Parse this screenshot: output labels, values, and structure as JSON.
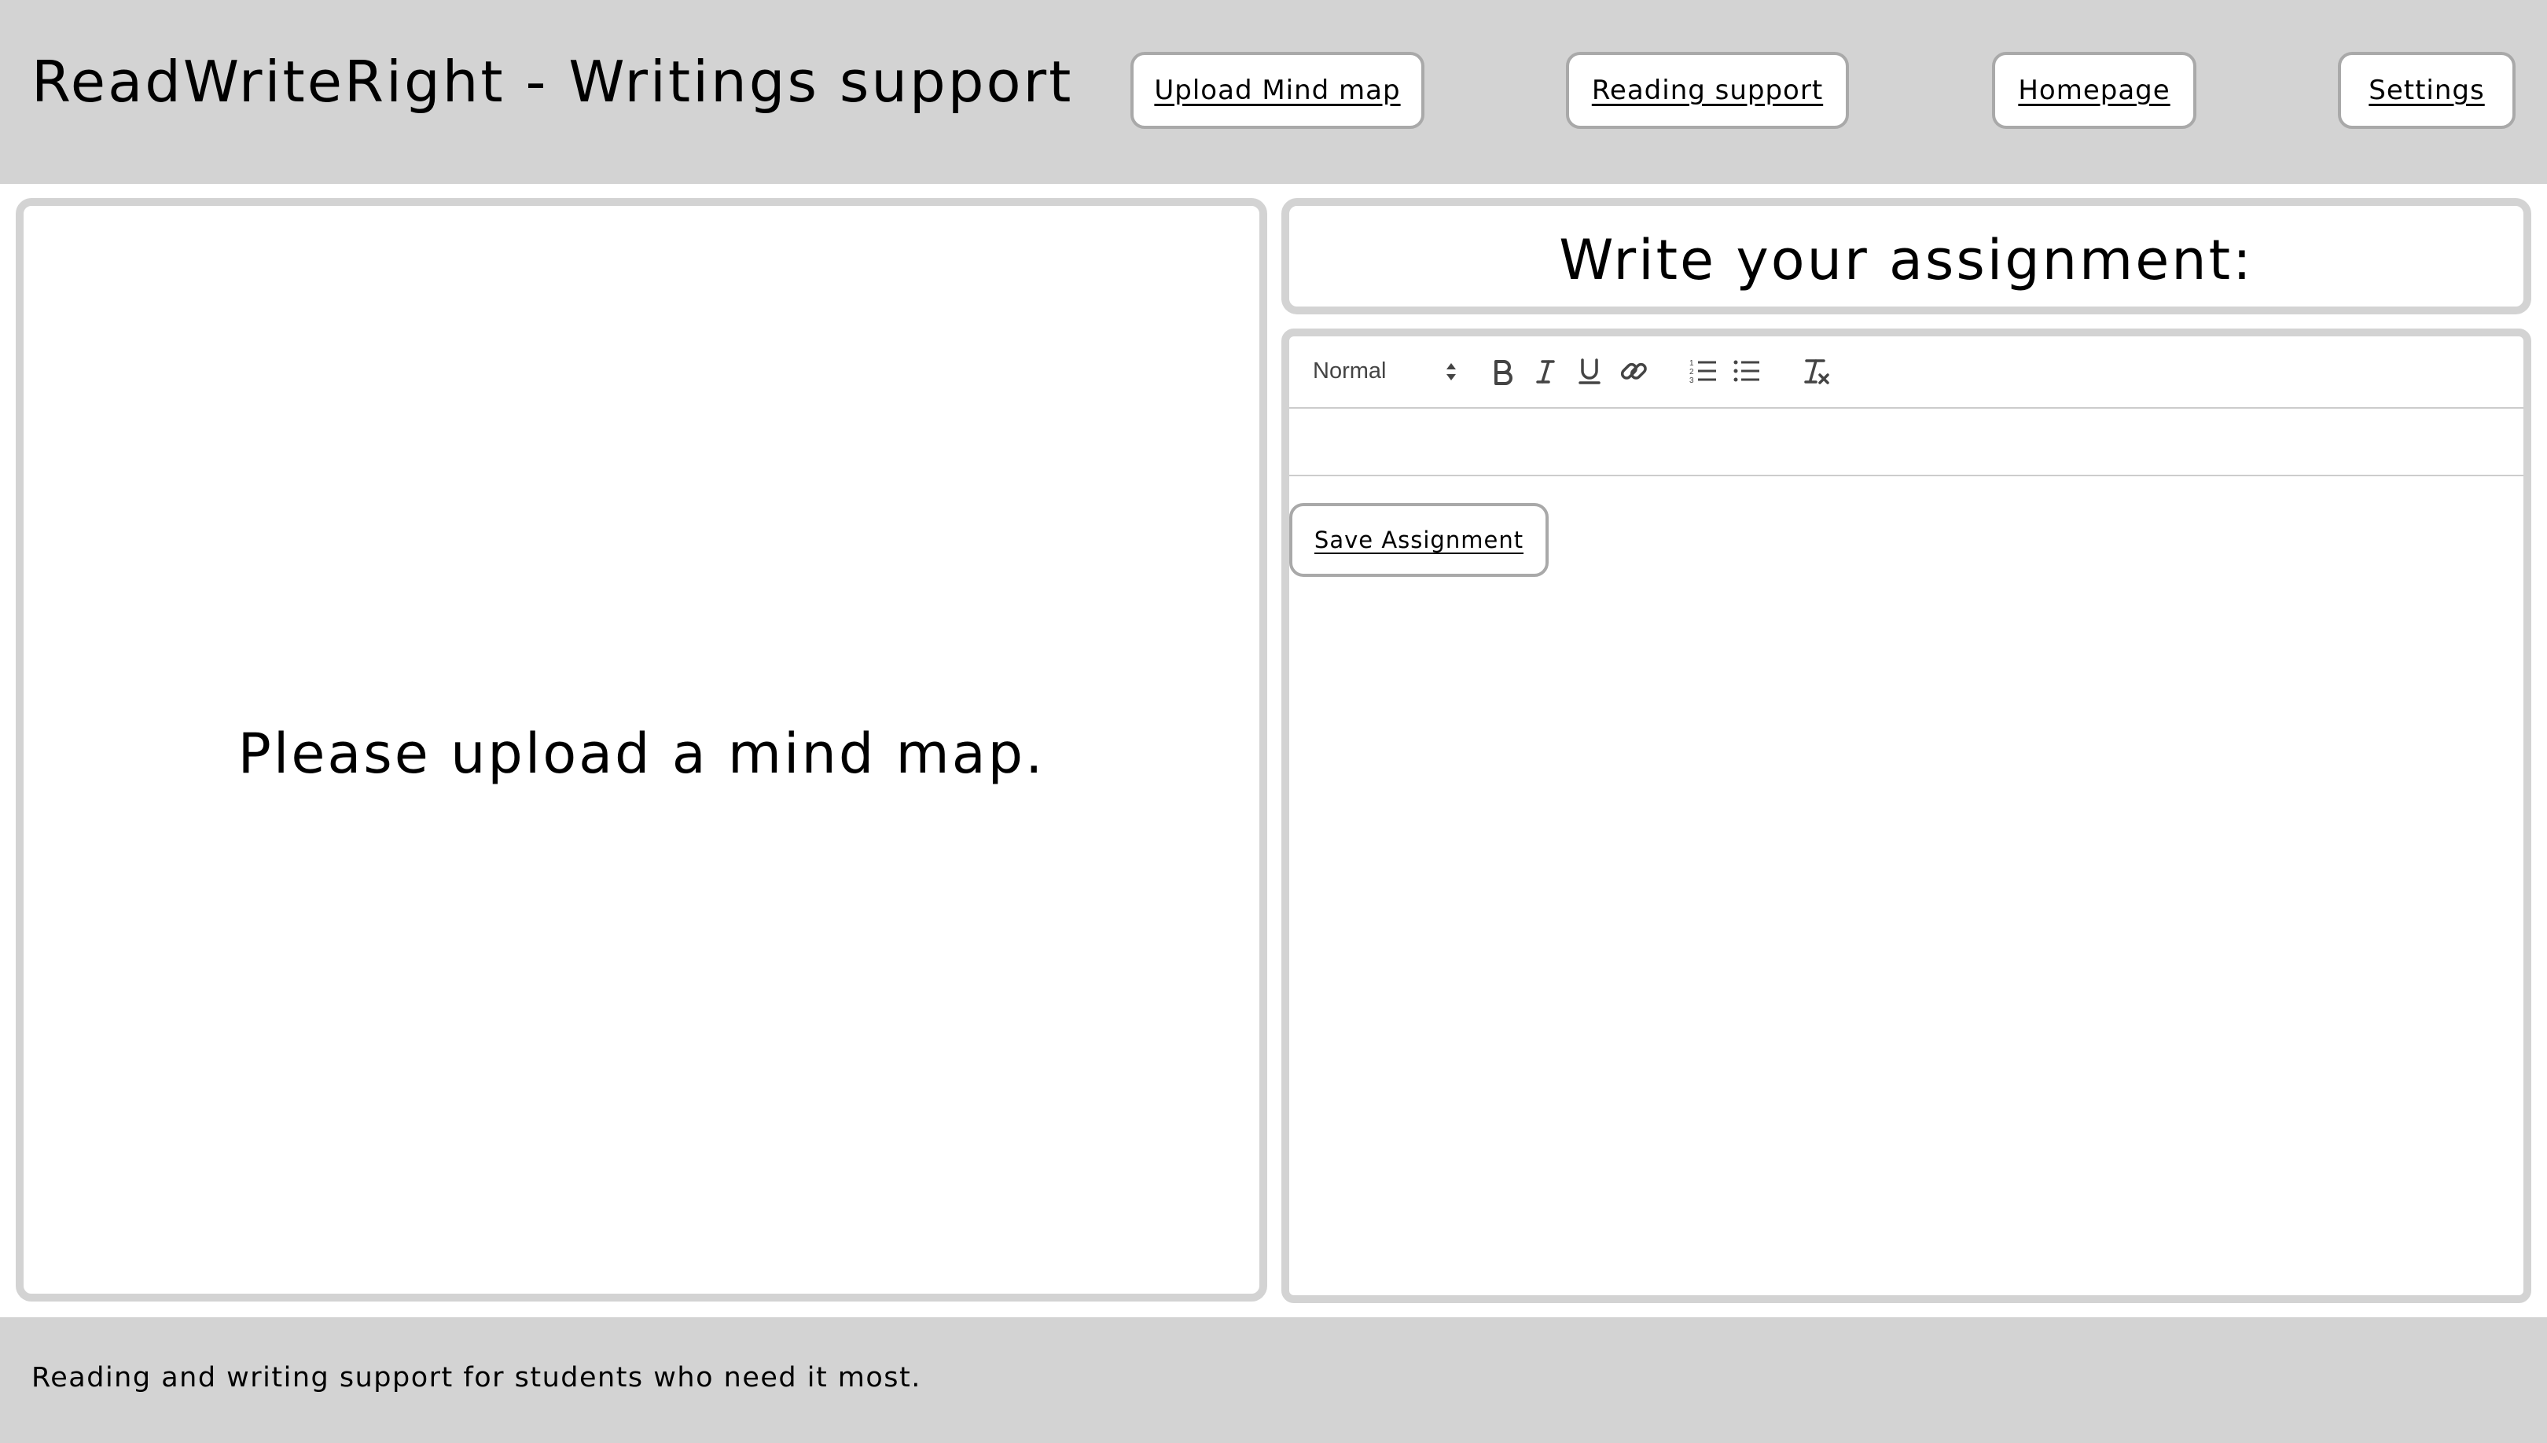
{
  "header": {
    "title": "ReadWriteRight - Writings support",
    "nav": {
      "upload_mind_map": "Upload Mind map",
      "reading_support": "Reading support",
      "homepage": "Homepage",
      "settings": "Settings"
    }
  },
  "left_panel": {
    "message": "Please upload a mind map."
  },
  "right_panel": {
    "title": "Write your assignment:",
    "editor": {
      "format_select": "Normal",
      "toolbar_icons": [
        "bold-icon",
        "italic-icon",
        "underline-icon",
        "link-icon",
        "ordered-list-icon",
        "bullet-list-icon",
        "clear-format-icon"
      ],
      "content": ""
    },
    "save_label": "Save Assignment"
  },
  "footer": {
    "text": "Reading and writing support for students who need it most."
  },
  "colors": {
    "header_bg": "#d3d3d3",
    "panel_border": "#d3d3d3",
    "button_border": "#a9a9a9",
    "toolbar_icon": "#444444"
  }
}
